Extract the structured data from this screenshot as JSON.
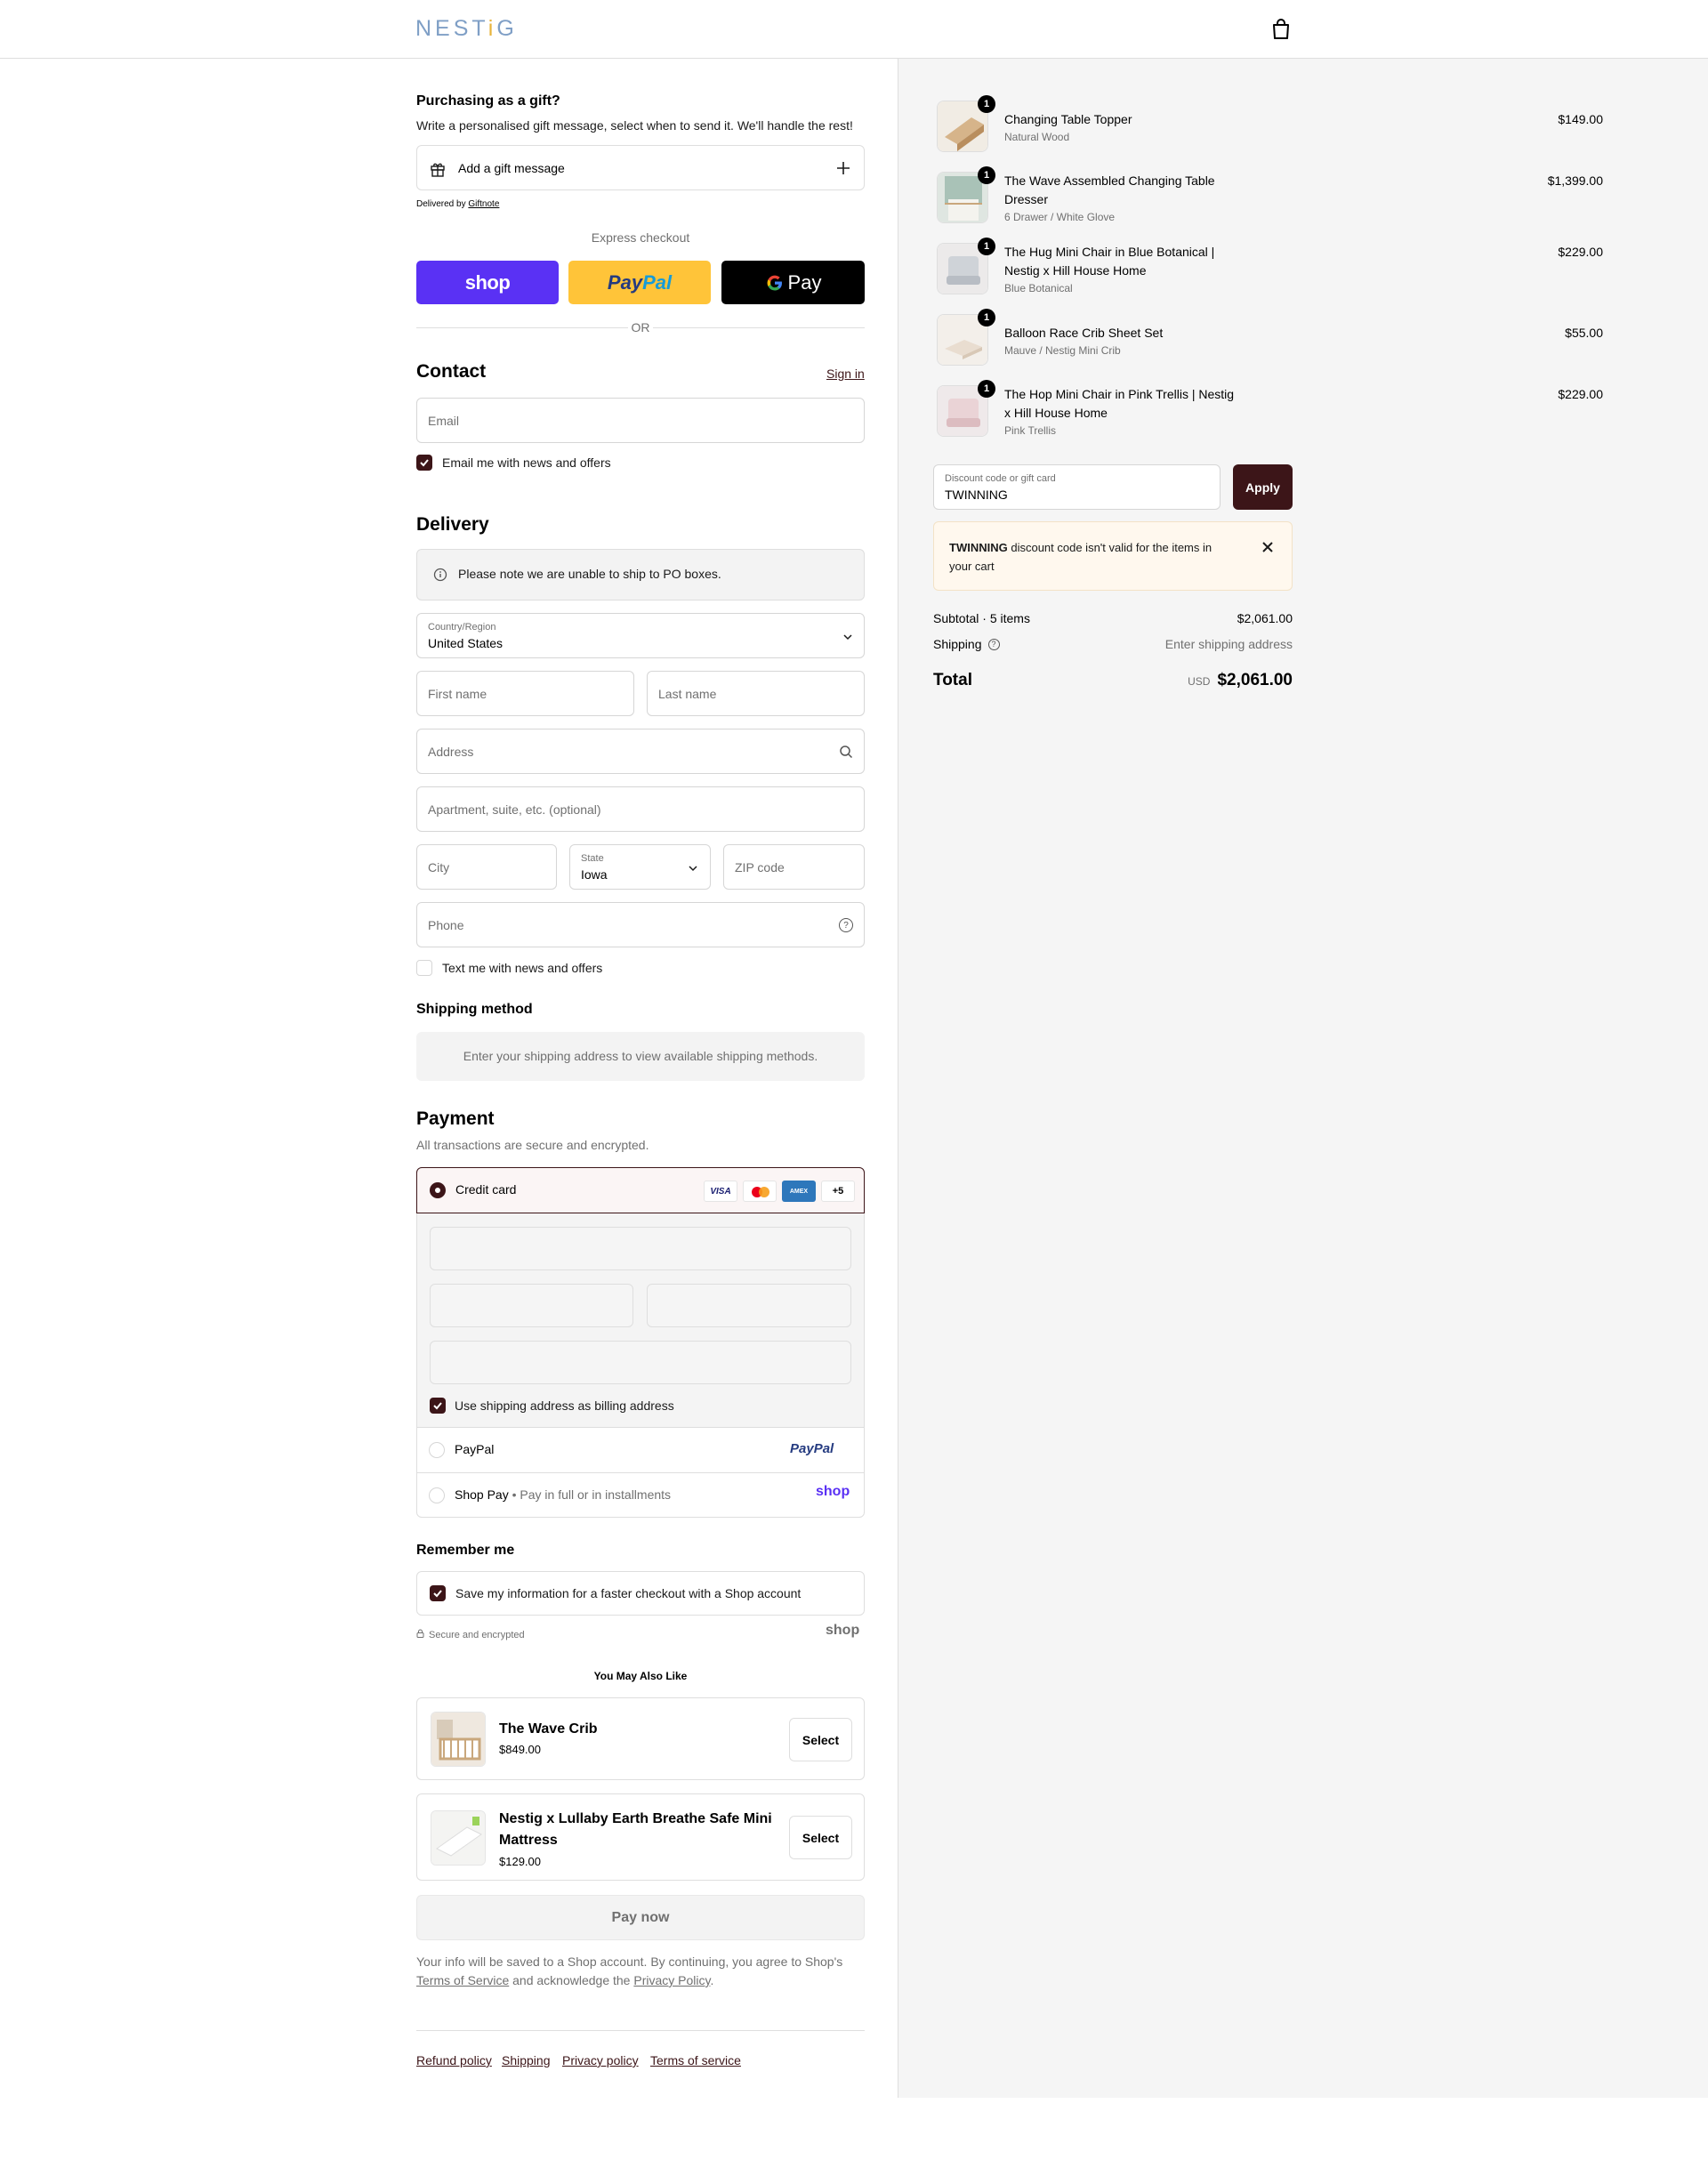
{
  "header": {
    "logo": "NESTiG",
    "logo_main": "NEST",
    "logo_i": "i",
    "logo_end": "G"
  },
  "gift": {
    "title": "Purchasing as a gift?",
    "desc": "Write a personalised gift message, select when to send it. We'll handle the rest!",
    "add_label": "Add a gift message",
    "delivered_by": "Delivered by",
    "delivered_link": "Giftnote"
  },
  "express": {
    "label": "Express checkout",
    "shop": "shop",
    "paypal_a": "Pay",
    "paypal_b": "Pal",
    "gpay": "Pay",
    "or": "OR"
  },
  "contact": {
    "title": "Contact",
    "sign_in": "Sign in",
    "email_placeholder": "Email",
    "news_label": "Email me with news and offers"
  },
  "delivery": {
    "title": "Delivery",
    "po_note": "Please note we are unable to ship to PO boxes.",
    "country_label": "Country/Region",
    "country_value": "United States",
    "first_name": "First name",
    "last_name": "Last name",
    "address": "Address",
    "apartment": "Apartment, suite, etc. (optional)",
    "city": "City",
    "state_label": "State",
    "state_value": "Iowa",
    "zip": "ZIP code",
    "phone": "Phone",
    "text_news": "Text me with news and offers"
  },
  "shipping_method": {
    "title": "Shipping method",
    "note": "Enter your shipping address to view available shipping methods."
  },
  "payment": {
    "title": "Payment",
    "subtitle": "All transactions are secure and encrypted.",
    "credit_card": "Credit card",
    "visa": "VISA",
    "amex": "AMEX",
    "more_cards": "+5",
    "billing_same": "Use shipping address as billing address",
    "paypal_label": "PayPal",
    "paypal_logo": "PayPal",
    "shoppay_label": "Shop Pay",
    "shoppay_sep": "•",
    "shoppay_sub": "Pay in full or in installments",
    "shoppay_logo": "shop"
  },
  "remember": {
    "title": "Remember me",
    "save_label": "Save my information for a faster checkout with a Shop account",
    "secure": "Secure and encrypted",
    "shop_logo": "shop"
  },
  "upsell": {
    "title": "You May Also Like",
    "items": [
      {
        "name": "The Wave Crib",
        "price": "$849.00",
        "button": "Select"
      },
      {
        "name": "Nestig x Lullaby Earth Breathe Safe Mini",
        "name2": "Mattress",
        "price": "$129.00",
        "button": "Select"
      }
    ]
  },
  "pay_now": "Pay now",
  "legal": {
    "line1": "Your info will be saved to a Shop account. By continuing, you agree to Shop's",
    "tos": "Terms of Service",
    "mid": "and acknowledge the",
    "privacy": "Privacy Policy",
    "end": "."
  },
  "footer_links": [
    "Refund policy",
    "Shipping",
    "Privacy policy",
    "Terms of service"
  ],
  "cart": {
    "items": [
      {
        "qty": "1",
        "title1": "Changing Table Topper",
        "title2": "",
        "variant": "Natural Wood",
        "price": "$149.00"
      },
      {
        "qty": "1",
        "title1": "The Wave Assembled Changing Table",
        "title2": "Dresser",
        "variant": "6 Drawer / White Glove",
        "price": "$1,399.00"
      },
      {
        "qty": "1",
        "title1": "The Hug Mini Chair in Blue Botanical |",
        "title2": "Nestig x Hill House Home",
        "variant": "Blue Botanical",
        "price": "$229.00"
      },
      {
        "qty": "1",
        "title1": "Balloon Race Crib Sheet Set",
        "title2": "",
        "variant": "Mauve / Nestig Mini Crib",
        "price": "$55.00"
      },
      {
        "qty": "1",
        "title1": "The Hop Mini Chair in Pink Trellis | Nestig",
        "title2": "x Hill House Home",
        "variant": "Pink Trellis",
        "price": "$229.00"
      }
    ],
    "discount_label": "Discount code or gift card",
    "discount_value": "TWINNING",
    "apply": "Apply",
    "error_code": "TWINNING",
    "error_text": "discount code isn't valid for the items in",
    "error_text2": "your cart",
    "subtotal_label": "Subtotal · 5 items",
    "subtotal_value": "$2,061.00",
    "shipping_label": "Shipping",
    "shipping_value": "Enter shipping address",
    "total_label": "Total",
    "currency": "USD",
    "total_value": "$2,061.00"
  },
  "colors": {
    "accent": "#3c1518",
    "shop": "#5a31f4",
    "paypal": "#ffc439",
    "error_bg": "#fff8ee"
  }
}
